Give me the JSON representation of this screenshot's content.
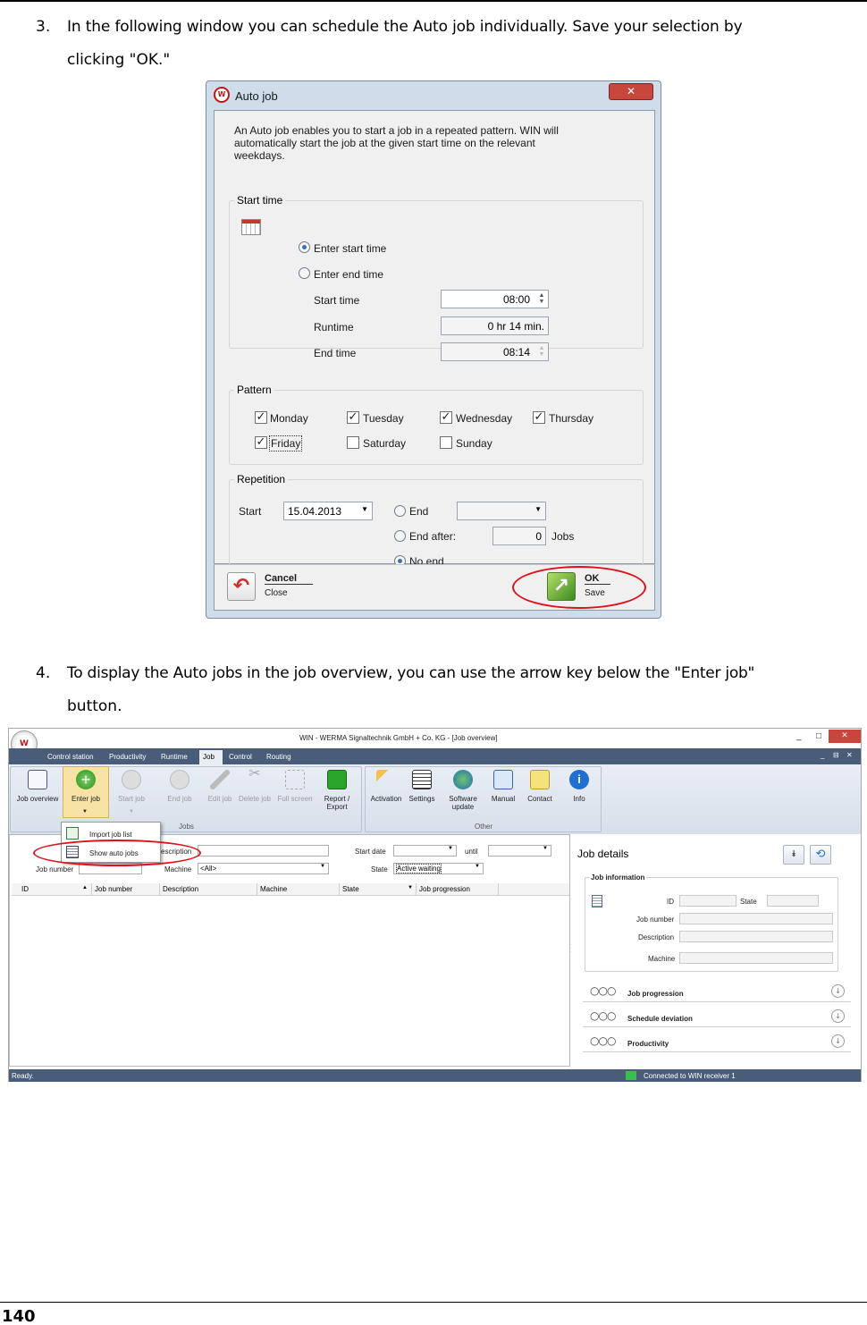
{
  "step3": {
    "number": "3.",
    "line1": "In the following window you can schedule the Auto job individually. Save your selection by",
    "line2": "clicking \"OK.\""
  },
  "dialog": {
    "title": "Auto job",
    "close_glyph": "✕",
    "intro_line1": "An Auto job enables you to start a job in a repeated pattern. WIN will",
    "intro_line2": "automatically start the job at the given start time on the relevant",
    "intro_line3": "weekdays.",
    "start_time_group": {
      "label": "Start time",
      "enter_start_time": "Enter start time",
      "enter_end_time": "Enter end time",
      "start_time_label": "Start time",
      "start_time_value": "08:00",
      "runtime_label": "Runtime",
      "runtime_value": "0 hr  14 min.",
      "end_time_label": "End time",
      "end_time_value": "08:14"
    },
    "pattern_group": {
      "label": "Pattern",
      "days": [
        {
          "name": "Monday",
          "checked": true
        },
        {
          "name": "Tuesday",
          "checked": true
        },
        {
          "name": "Wednesday",
          "checked": true
        },
        {
          "name": "Thursday",
          "checked": true
        },
        {
          "name": "Friday",
          "checked": true
        },
        {
          "name": "Saturday",
          "checked": false
        },
        {
          "name": "Sunday",
          "checked": false
        }
      ]
    },
    "repetition_group": {
      "label": "Repetition",
      "start_label": "Start",
      "start_value": "15.04.2013",
      "end_label": "End",
      "end_after_label": "End after:",
      "end_after_value": "0",
      "jobs_label": "Jobs",
      "no_end_label": "No end"
    },
    "cancel": {
      "label": "Cancel",
      "sub": "Close"
    },
    "ok": {
      "label": "OK",
      "sub": "Save"
    }
  },
  "step4": {
    "number": "4.",
    "line1": "To display the Auto jobs in the job overview, you can use the arrow key below the \"Enter job\"",
    "line2": "button."
  },
  "app": {
    "title": "WIN - WERMA Signaltechnik GmbH + Co. KG - [Job overview]",
    "window_controls": [
      "_",
      "□",
      "✕"
    ],
    "sub_controls": [
      "_",
      "⊟",
      "✕"
    ],
    "menu_tabs": [
      "Control station",
      "Productivity",
      "Runtime",
      "Job",
      "Control",
      "Routing"
    ],
    "active_tab": "Job",
    "toolbar_jobs": [
      {
        "label": "Job overview",
        "enabled": true
      },
      {
        "label": "Enter job",
        "enabled": true
      },
      {
        "label": "Start job",
        "enabled": false
      },
      {
        "label": "End job",
        "enabled": false
      },
      {
        "label": "Edit job",
        "enabled": false
      },
      {
        "label": "Delete job",
        "enabled": false
      },
      {
        "label": "Full screen",
        "enabled": false
      },
      {
        "label": "Report / Export",
        "enabled": true
      }
    ],
    "toolbar_other": [
      {
        "label": "Activation"
      },
      {
        "label": "Settings"
      },
      {
        "label": "Software update"
      },
      {
        "label": "Manual"
      },
      {
        "label": "Contact"
      },
      {
        "label": "Info"
      }
    ],
    "group_jobs": "Jobs",
    "group_other": "Other",
    "dropdown_items": [
      "Import job list",
      "Show auto jobs"
    ],
    "filters": {
      "description_label": "escription",
      "job_number_label": "Job number",
      "machine_label": "Machine",
      "machine_value": "<All>",
      "start_date_label": "Start date",
      "until_label": "until",
      "state_label": "State",
      "state_value": "Active waiting"
    },
    "columns": [
      "ID",
      "Job number",
      "Description",
      "Machine",
      "State",
      "Job progression"
    ],
    "details": {
      "title": "Job details",
      "info_title": "Job information",
      "id_label": "ID",
      "state_label": "State",
      "job_number_label": "Job number",
      "description_label": "Description",
      "machine_label": "Machine",
      "sections": [
        "Job progression",
        "Schedule deviation",
        "Productivity"
      ]
    },
    "status_left": "Ready.",
    "status_right": "Connected to WIN receiver 1"
  },
  "page_number": "140"
}
